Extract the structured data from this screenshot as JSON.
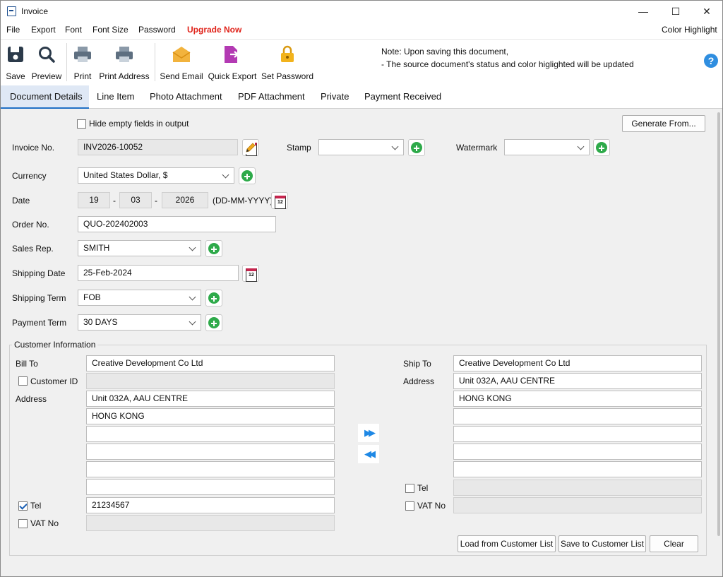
{
  "window": {
    "title": "Invoice",
    "controls": {
      "minimize": "—",
      "maximize": "☐",
      "close": "✕"
    }
  },
  "menu": {
    "items": [
      "File",
      "Export",
      "Font",
      "Font Size",
      "Password"
    ],
    "upgrade": "Upgrade Now",
    "color_highlight": "Color Highlight"
  },
  "toolbar": {
    "save": "Save",
    "preview": "Preview",
    "print": "Print",
    "print_address": "Print Address",
    "send_email": "Send Email",
    "quick_export": "Quick Export",
    "set_password": "Set Password",
    "note_line1": "Note: Upon saving this document,",
    "note_line2": "- The source document's status and color higlighted will be updated",
    "help": "?"
  },
  "tabs": [
    "Document Details",
    "Line Item",
    "Photo Attachment",
    "PDF Attachment",
    "Private",
    "Payment Received"
  ],
  "form": {
    "hide_empty_label": "Hide empty fields in output",
    "hide_empty_checked": false,
    "generate_from": "Generate From...",
    "invoice_no_label": "Invoice No.",
    "invoice_no": "INV2026-10052",
    "stamp_label": "Stamp",
    "stamp_value": "",
    "watermark_label": "Watermark",
    "watermark_value": "",
    "currency_label": "Currency",
    "currency": "United States Dollar, $",
    "date_label": "Date",
    "date_day": "19",
    "date_month": "03",
    "date_year": "2026",
    "date_sep": "-",
    "date_format": "(DD-MM-YYYY)",
    "order_no_label": "Order No.",
    "order_no": "QUO-202402003",
    "sales_rep_label": "Sales Rep.",
    "sales_rep": "SMITH",
    "shipping_date_label": "Shipping Date",
    "shipping_date": "25-Feb-2024",
    "shipping_term_label": "Shipping Term",
    "shipping_term": "FOB",
    "payment_term_label": "Payment Term",
    "payment_term": "30 DAYS",
    "calendar_glyph": "12"
  },
  "customer": {
    "group_title": "Customer Information",
    "bill_to_label": "Bill To",
    "bill_to": "Creative Development Co Ltd",
    "customer_id_label": "Customer ID",
    "customer_id": "",
    "address_label": "Address",
    "bill_address": [
      "Unit 032A, AAU CENTRE",
      "HONG KONG",
      "",
      "",
      "",
      ""
    ],
    "tel_label": "Tel",
    "tel": "21234567",
    "tel_checked": true,
    "vat_label": "VAT No",
    "vat": "",
    "ship_to_label": "Ship To",
    "ship_to": "Creative Development Co Ltd",
    "ship_address_label": "Address",
    "ship_address": [
      "Unit 032A, AAU CENTRE",
      "HONG KONG",
      "",
      "",
      "",
      ""
    ],
    "ship_tel_label": "Tel",
    "ship_vat_label": "VAT No",
    "copy_right": "▶▶",
    "copy_left": "◀◀",
    "load_btn": "Load from Customer List",
    "save_btn": "Save to Customer List",
    "clear_btn": "Clear"
  },
  "colors": {
    "accent": "#1f6fc5",
    "upgrade": "#e0241b",
    "add_green": "#2eaa4a",
    "email": "#f2b33d",
    "export": "#b33ab3",
    "lock": "#f2b31c"
  }
}
